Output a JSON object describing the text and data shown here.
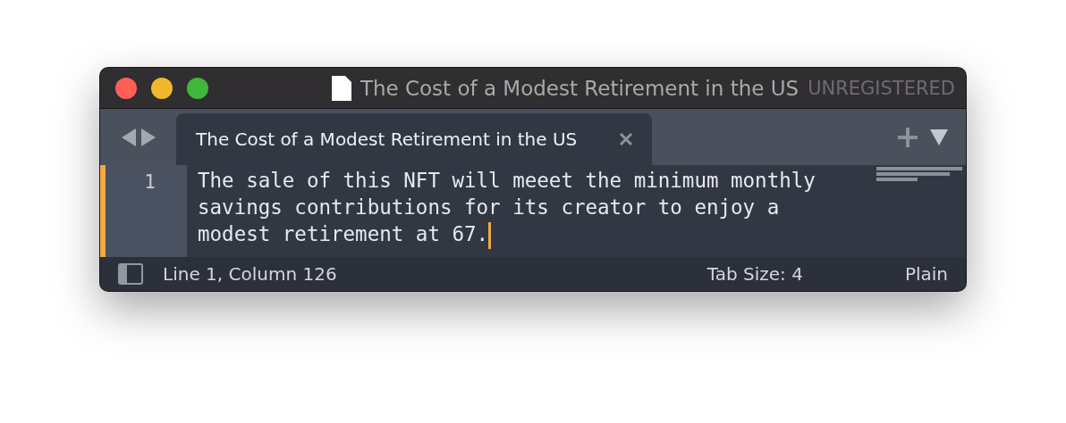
{
  "window": {
    "title": "The Cost of a Modest Retirement in the US",
    "registration": "UNREGISTERED"
  },
  "tabs": [
    {
      "label": "The Cost of a Modest Retirement in the US",
      "selected": true
    }
  ],
  "editor": {
    "lines": [
      {
        "number": "1",
        "text": "The sale of this NFT will meeet the minimum monthly savings contributions for its creator to enjoy a modest retirement at 67.",
        "current": true
      }
    ]
  },
  "status_bar": {
    "position": "Line 1, Column 126",
    "tab_size": "Tab Size: 4",
    "syntax": "Plain"
  }
}
